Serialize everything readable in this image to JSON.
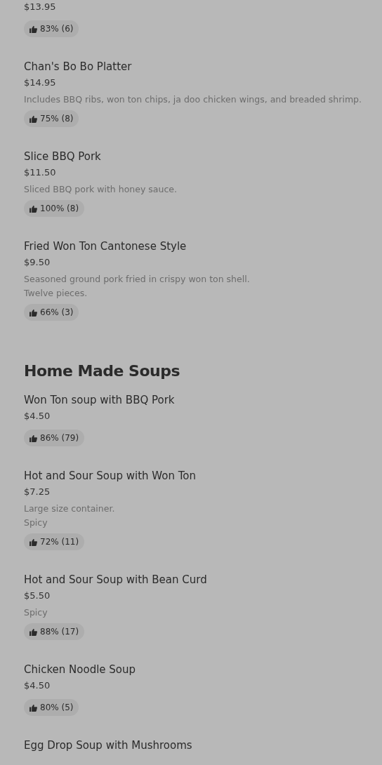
{
  "sections": [
    {
      "items": [
        {
          "price": "$13.95",
          "rating": "83% (6)"
        },
        {
          "name": "Chan's Bo Bo Platter",
          "price": "$14.95",
          "description": [
            "Includes BBQ ribs, won ton chips, ja doo chicken wings, and breaded shrimp."
          ],
          "rating": "75% (8)"
        },
        {
          "name": "Slice BBQ Pork",
          "price": "$11.50",
          "description": [
            "Sliced BBQ pork with honey sauce."
          ],
          "rating": "100% (8)"
        },
        {
          "name": "Fried Won Ton Cantonese Style",
          "price": "$9.50",
          "description": [
            "Seasoned ground pork fried in crispy won ton shell.",
            "Twelve pieces."
          ],
          "rating": "66% (3)"
        }
      ]
    },
    {
      "title": "Home Made Soups",
      "items": [
        {
          "name": "Won Ton soup with BBQ Pork",
          "price": "$4.50",
          "rating": "86% (79)"
        },
        {
          "name": "Hot and Sour Soup with Won Ton",
          "price": "$7.25",
          "description": [
            "Large size container.",
            "Spicy"
          ],
          "rating": "72% (11)"
        },
        {
          "name": "Hot and Sour Soup with Bean Curd",
          "price": "$5.50",
          "description": [
            "Spicy"
          ],
          "rating": "88% (17)"
        },
        {
          "name": "Chicken Noodle Soup",
          "price": "$4.50",
          "rating": "80% (5)"
        },
        {
          "name": "Egg Drop Soup with Mushrooms"
        }
      ]
    }
  ]
}
